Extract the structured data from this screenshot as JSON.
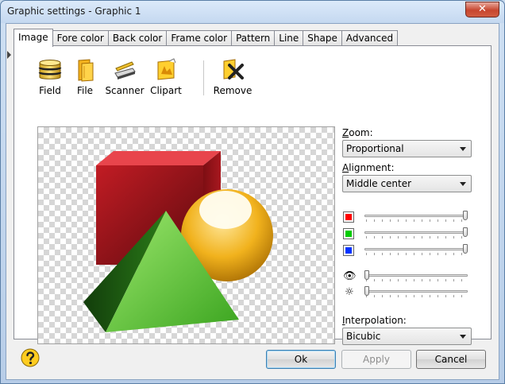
{
  "window": {
    "title": "Graphic settings - Graphic 1",
    "close_glyph": "✕"
  },
  "tabs": [
    {
      "label": "Image",
      "active": true
    },
    {
      "label": "Fore color",
      "active": false
    },
    {
      "label": "Back color",
      "active": false
    },
    {
      "label": "Frame color",
      "active": false
    },
    {
      "label": "Pattern",
      "active": false
    },
    {
      "label": "Line",
      "active": false
    },
    {
      "label": "Shape",
      "active": false
    },
    {
      "label": "Advanced",
      "active": false
    }
  ],
  "toolbar": {
    "field": {
      "label": "Field",
      "icon": "database-icon"
    },
    "file": {
      "label": "File",
      "icon": "folder-icon"
    },
    "scanner": {
      "label": "Scanner",
      "icon": "scanner-icon"
    },
    "clipart": {
      "label": "Clipart",
      "icon": "clipart-icon"
    },
    "remove": {
      "label": "Remove",
      "icon": "remove-icon"
    }
  },
  "zoom": {
    "label_key": "Z",
    "label_rest": "oom:",
    "value": "Proportional"
  },
  "alignment": {
    "label_key": "A",
    "label_rest": "lignment:",
    "value": "Middle center"
  },
  "color_sliders": [
    {
      "name": "red",
      "color": "#ff0000",
      "level": 1.0
    },
    {
      "name": "green",
      "color": "#00cc00",
      "level": 1.0
    },
    {
      "name": "blue",
      "color": "#0033ff",
      "level": 1.0
    }
  ],
  "adjust_sliders": [
    {
      "name": "transparency",
      "icon": "eye-icon",
      "glyph": "👁",
      "level": 0.0
    },
    {
      "name": "brightness",
      "icon": "brightness-icon",
      "glyph": "☼",
      "level": 0.0
    }
  ],
  "interpolation": {
    "label_key": "I",
    "label_rest": "nterpolation:",
    "value": "Bicubic"
  },
  "buttons": {
    "ok": "Ok",
    "apply": "Apply",
    "cancel": "Cancel"
  },
  "colors": {
    "accent": "#3c7fb1",
    "panel": "#ffffff"
  }
}
